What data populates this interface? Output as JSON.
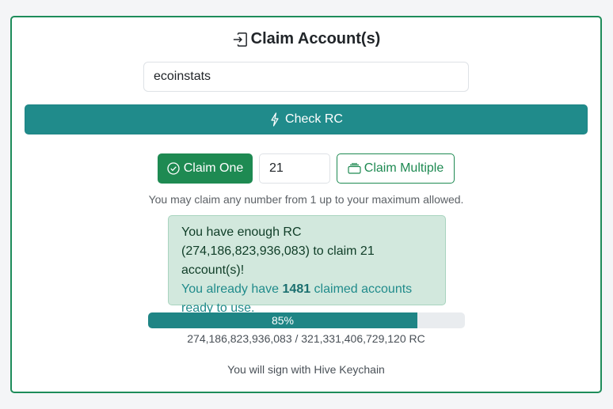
{
  "title": {
    "text": "Claim Account(s)",
    "icon": "login-icon"
  },
  "account_input": {
    "value": "ecoinstats"
  },
  "check_button": {
    "label": "Check RC",
    "icon": "lightning-icon"
  },
  "claim": {
    "one_label": "Claim One",
    "one_icon": "check-circle-icon",
    "quantity_value": "21",
    "multiple_label": "Claim Multiple",
    "multiple_icon": "stack-icon",
    "hint": "You may claim any number from 1 up to your maximum allowed."
  },
  "alert": {
    "line1": "You have enough RC (274,186,823,936,083) to claim 21 account(s)!",
    "line2_prefix": "You already have ",
    "claimed_count": "1481",
    "line2_suffix": " claimed accounts ready to use."
  },
  "progress": {
    "percent": 85,
    "label": "85%",
    "rc_text": "274,186,823,936,083 / 321,331,406,729,120 RC"
  },
  "footer": {
    "sign_note": "You will sign with Hive Keychain"
  },
  "colors": {
    "card_border": "#1e8c5a",
    "teal_button": "#208b8b",
    "success_green": "#1e8a52",
    "alert_bg": "#d2e8dd"
  }
}
